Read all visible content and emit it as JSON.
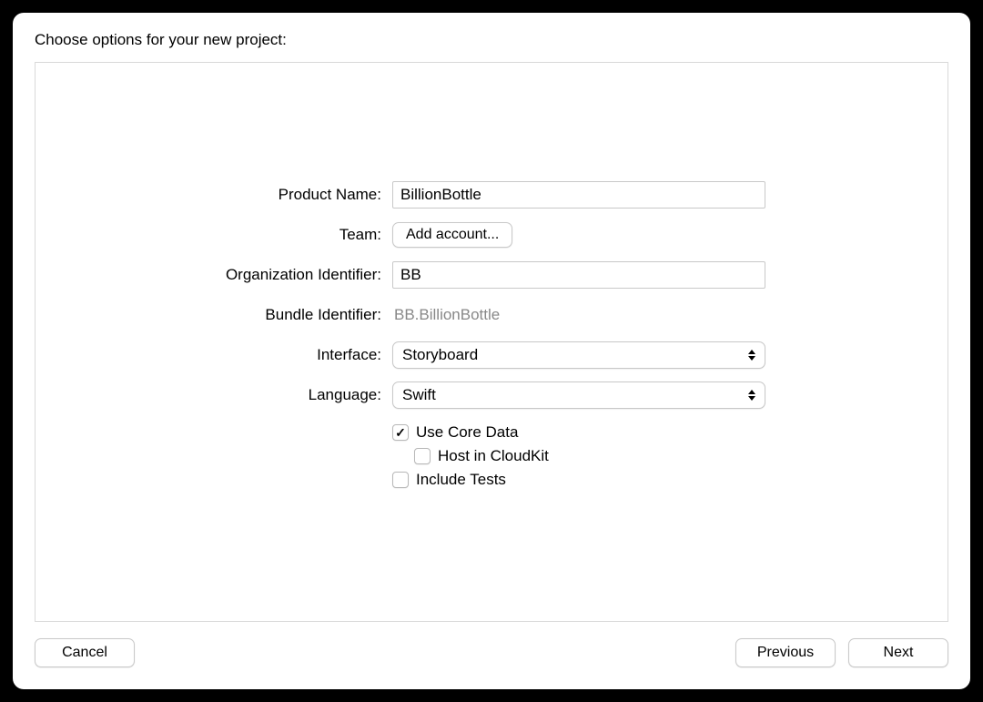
{
  "heading": "Choose options for your new project:",
  "labels": {
    "product_name": "Product Name:",
    "team": "Team:",
    "org_identifier": "Organization Identifier:",
    "bundle_identifier": "Bundle Identifier:",
    "interface": "Interface:",
    "language": "Language:"
  },
  "fields": {
    "product_name": "BillionBottle",
    "team_button": "Add account...",
    "org_identifier": "BB",
    "bundle_identifier": "BB.BillionBottle",
    "interface": "Storyboard",
    "language": "Swift"
  },
  "checkboxes": {
    "use_core_data": {
      "label": "Use Core Data",
      "checked": true
    },
    "host_in_cloudkit": {
      "label": "Host in CloudKit",
      "checked": false
    },
    "include_tests": {
      "label": "Include Tests",
      "checked": false
    }
  },
  "buttons": {
    "cancel": "Cancel",
    "previous": "Previous",
    "next": "Next"
  }
}
